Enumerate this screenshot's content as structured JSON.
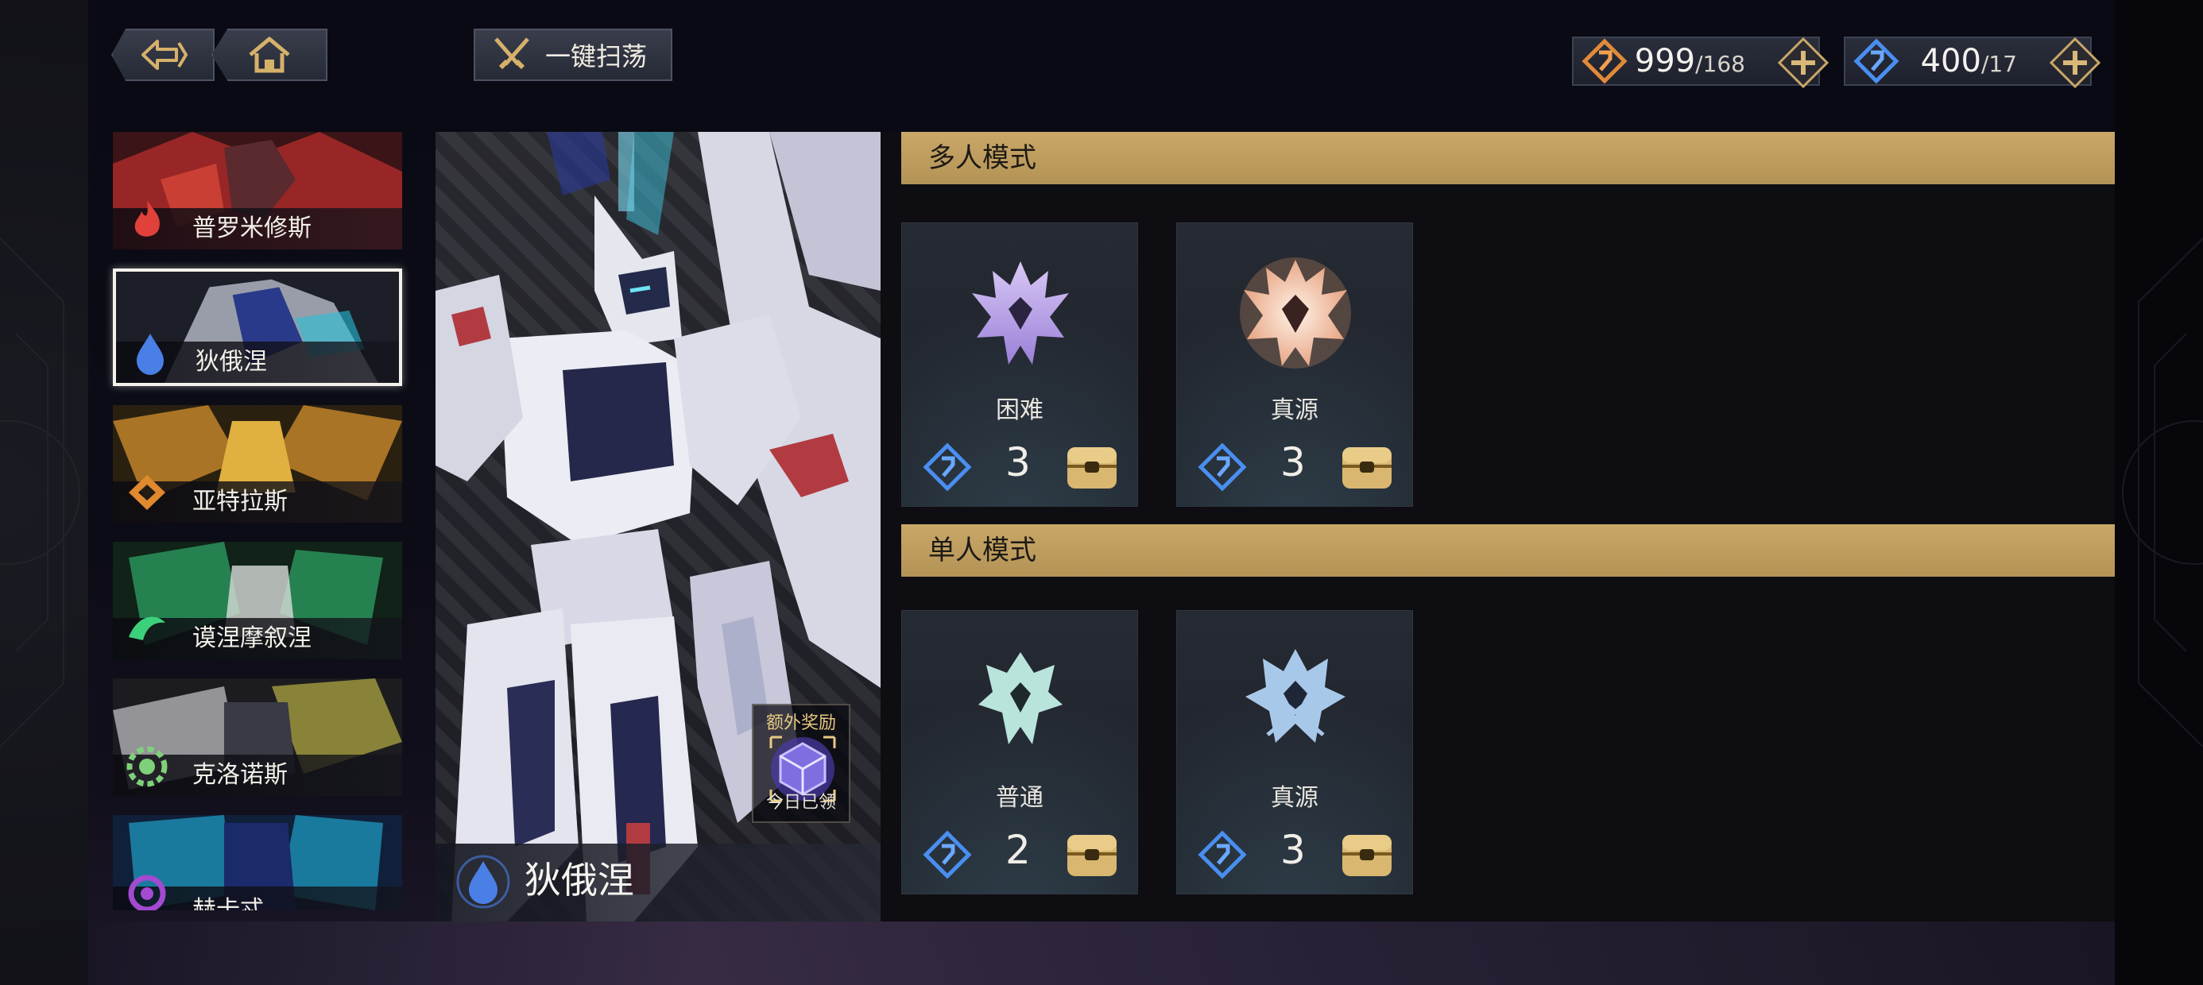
{
  "topbar": {
    "back_icon": "back-arrow-icon",
    "home_icon": "home-icon",
    "sweep_label": "一键扫荡",
    "currency_gold": {
      "value": "999",
      "max": "/168"
    },
    "currency_blue": {
      "value": "400",
      "max": "/17"
    }
  },
  "mech_list": [
    {
      "name": "普罗米修斯",
      "element": "fire",
      "color": "#e0413a"
    },
    {
      "name": "狄俄涅",
      "element": "water",
      "color": "#4a7fe6",
      "selected": true
    },
    {
      "name": "亚特拉斯",
      "element": "earth",
      "color": "#e0892f"
    },
    {
      "name": "谟涅摩叙涅",
      "element": "wind",
      "color": "#3dd07a"
    },
    {
      "name": "克洛诺斯",
      "element": "light",
      "color": "#7fd07a"
    },
    {
      "name": "赫卡忒",
      "element": "dark",
      "color": "#a24ad0"
    }
  ],
  "portrait": {
    "name": "狄俄涅",
    "bonus_title": "额外奖励",
    "bonus_status": "今日已领"
  },
  "multi_mode": {
    "title": "多人模式",
    "cards": [
      {
        "name": "困难",
        "cost": "3"
      },
      {
        "name": "真源",
        "cost": "3"
      }
    ]
  },
  "single_mode": {
    "title": "单人模式",
    "cards": [
      {
        "name": "普通",
        "cost": "2"
      },
      {
        "name": "真源",
        "cost": "3"
      }
    ]
  }
}
